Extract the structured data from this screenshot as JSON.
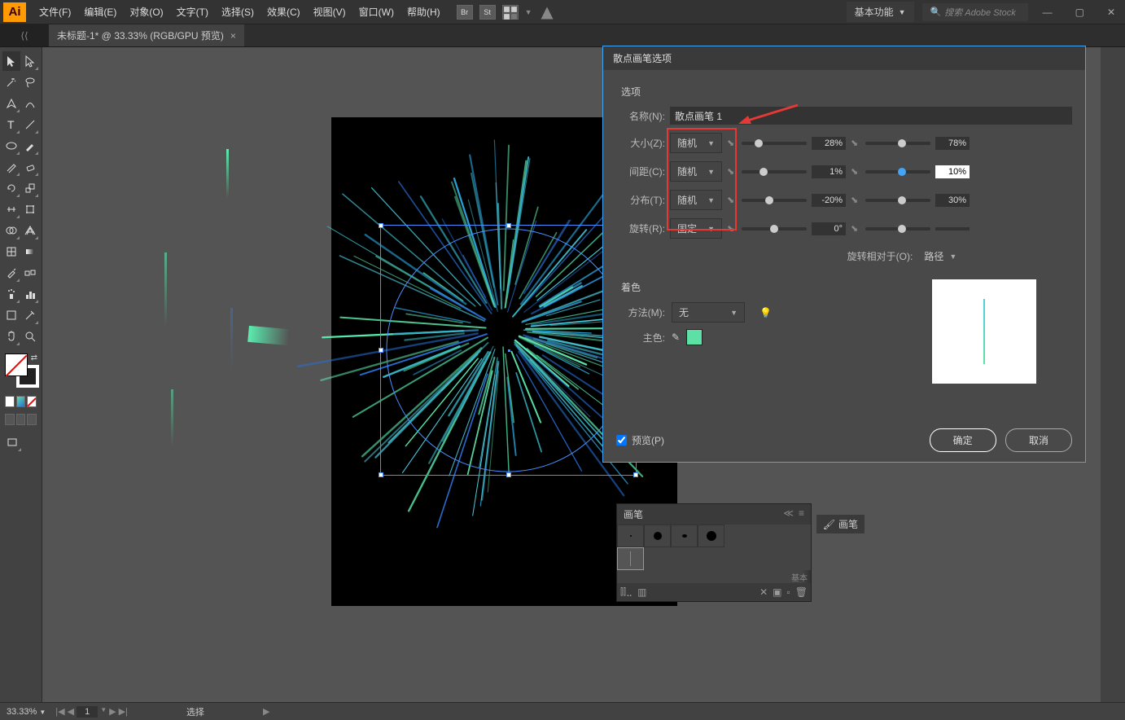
{
  "top": {
    "logo": "Ai",
    "menus": [
      "文件(F)",
      "编辑(E)",
      "对象(O)",
      "文字(T)",
      "选择(S)",
      "效果(C)",
      "视图(V)",
      "窗口(W)",
      "帮助(H)"
    ],
    "workspace": "基本功能",
    "search_placeholder": "搜索 Adobe Stock"
  },
  "tab": {
    "title": "未标题-1* @ 33.33% (RGB/GPU 预览)"
  },
  "brushes_panel": {
    "title": "画笔",
    "label_side": "画笔",
    "footer_label": "基本"
  },
  "dialog": {
    "title": "散点画笔选项",
    "section_options": "选项",
    "name_label": "名称(N):",
    "name_value": "散点画笔 1",
    "rows": [
      {
        "label": "大小(Z):",
        "dd": "随机",
        "v1": "28%",
        "v2": "78%"
      },
      {
        "label": "间距(C):",
        "dd": "随机",
        "v1": "1%",
        "v2": "10%",
        "editing": true
      },
      {
        "label": "分布(T):",
        "dd": "随机",
        "v1": "-20%",
        "v2": "30%"
      },
      {
        "label": "旋转(R):",
        "dd": "固定",
        "v1": "0°",
        "v2": ""
      }
    ],
    "rotate_rel_label": "旋转相对于(O):",
    "rotate_rel_value": "路径",
    "section_coloring": "着色",
    "method_label": "方法(M):",
    "method_value": "无",
    "keycolor_label": "主色:",
    "preview_label": "预览(P)",
    "ok": "确定",
    "cancel": "取消"
  },
  "status": {
    "zoom": "33.33%",
    "page": "1",
    "tool": "选择"
  }
}
